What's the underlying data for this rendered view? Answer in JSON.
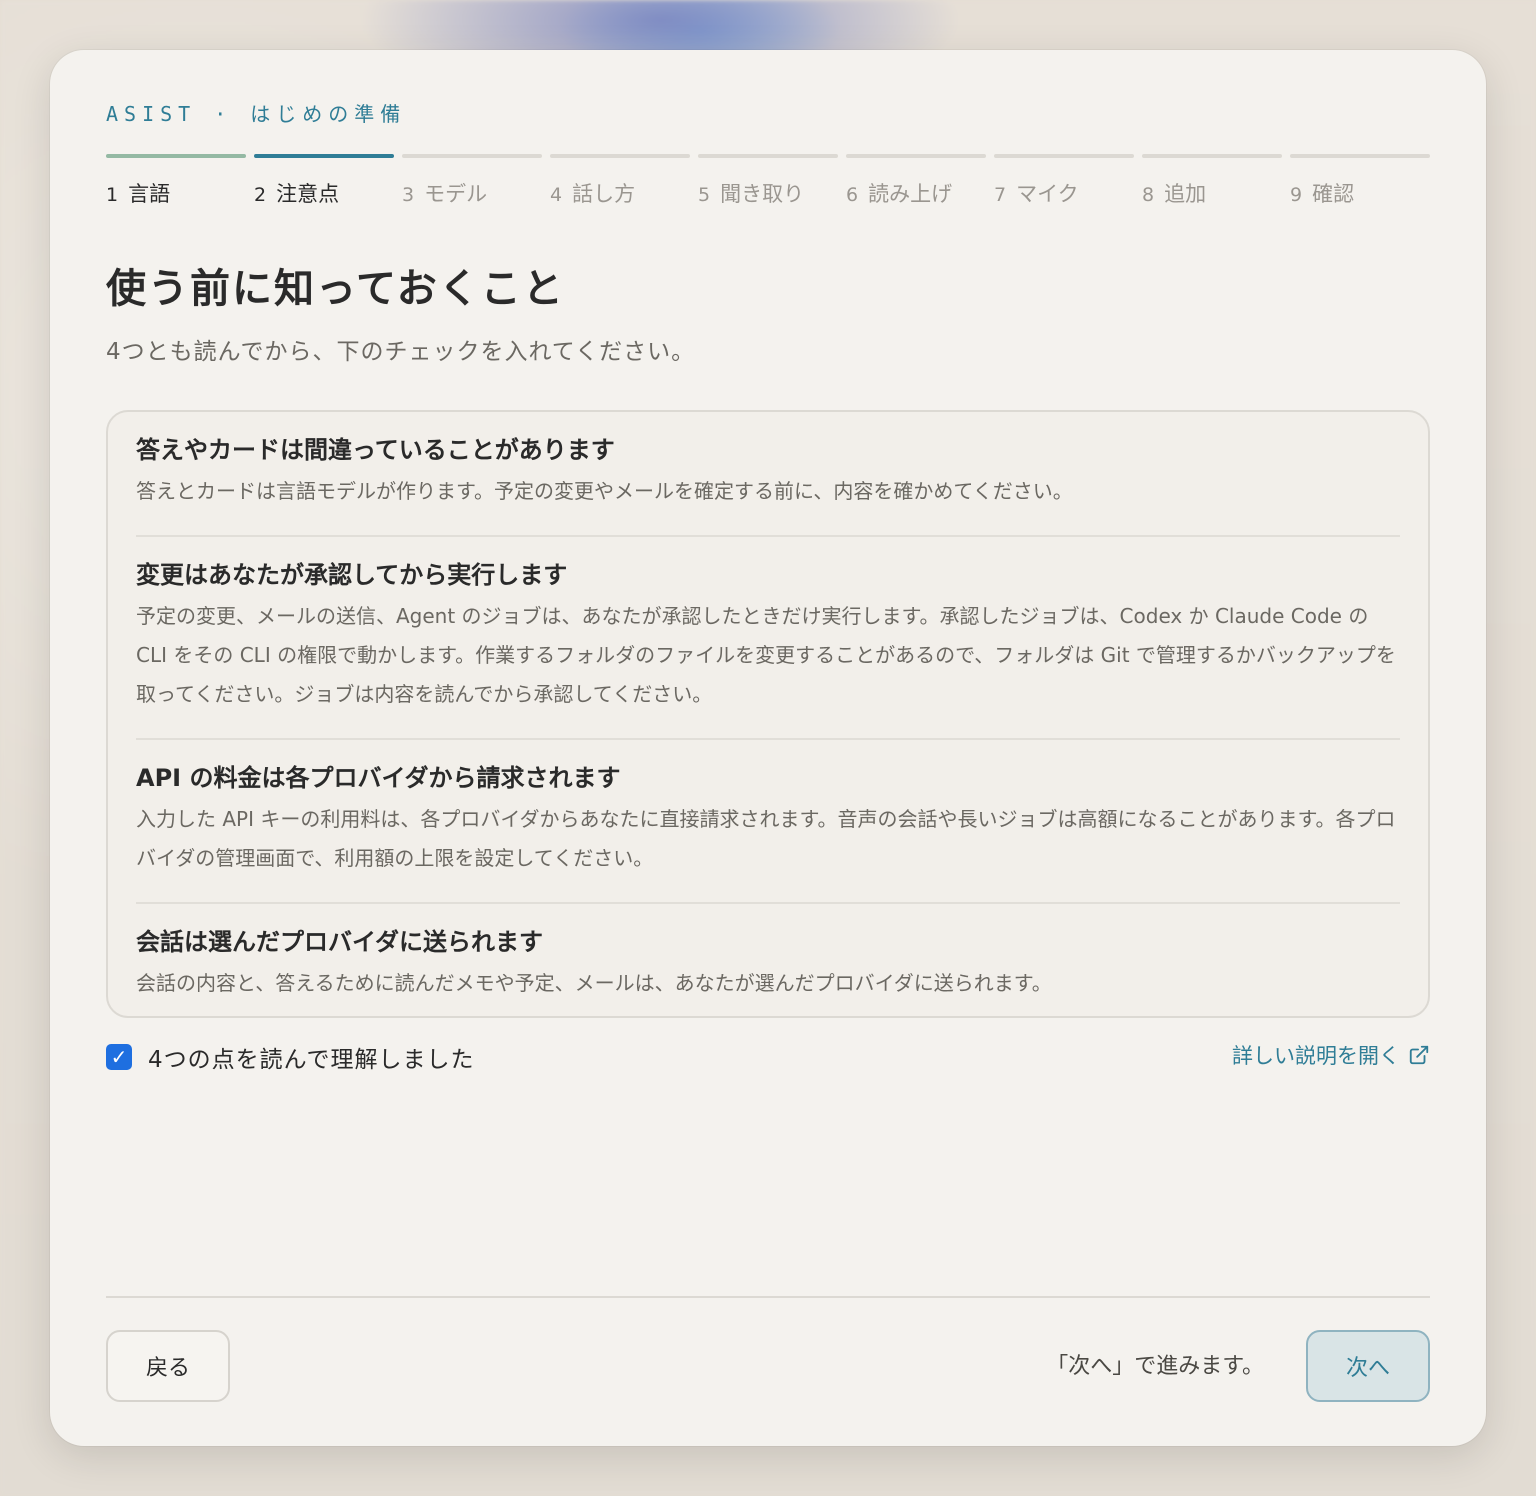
{
  "header": {
    "brand": "ASIST",
    "separator": "·",
    "section": "はじめの準備"
  },
  "steps": [
    {
      "num": "1",
      "label": "言語",
      "state": "done"
    },
    {
      "num": "2",
      "label": "注意点",
      "state": "active"
    },
    {
      "num": "3",
      "label": "モデル",
      "state": "pending"
    },
    {
      "num": "4",
      "label": "話し方",
      "state": "pending"
    },
    {
      "num": "5",
      "label": "聞き取り",
      "state": "pending"
    },
    {
      "num": "6",
      "label": "読み上げ",
      "state": "pending"
    },
    {
      "num": "7",
      "label": "マイク",
      "state": "pending"
    },
    {
      "num": "8",
      "label": "追加",
      "state": "pending"
    },
    {
      "num": "9",
      "label": "確認",
      "state": "pending"
    }
  ],
  "page": {
    "title": "使う前に知っておくこと",
    "subtitle": "4つとも読んでから、下のチェックを入れてください。"
  },
  "notices": [
    {
      "title": "答えやカードは間違っていることがあります",
      "body": "答えとカードは言語モデルが作ります。予定の変更やメールを確定する前に、内容を確かめてください。"
    },
    {
      "title": "変更はあなたが承認してから実行します",
      "body": "予定の変更、メールの送信、Agent のジョブは、あなたが承認したときだけ実行します。承認したジョブは、Codex か Claude Code の CLI をその CLI の権限で動かします。作業するフォルダのファイルを変更することがあるので、フォルダは Git で管理するかバックアップを取ってください。ジョブは内容を読んでから承認してください。"
    },
    {
      "title": "API の料金は各プロバイダから請求されます",
      "body": "入力した API キーの利用料は、各プロバイダからあなたに直接請求されます。音声の会話や長いジョブは高額になることがあります。各プロバイダの管理画面で、利用額の上限を設定してください。"
    },
    {
      "title": "会話は選んだプロバイダに送られます",
      "body": "会話の内容と、答えるために読んだメモや予定、メールは、あなたが選んだプロバイダに送られます。"
    }
  ],
  "agreement": {
    "label": "4つの点を読んで理解しました",
    "checked": true
  },
  "details_link": {
    "label": "詳しい説明を開く",
    "icon": "external-link-icon"
  },
  "footer": {
    "back_label": "戻る",
    "hint": "「次へ」で進みます。",
    "next_label": "次へ"
  },
  "colors": {
    "accent": "#2f7d96",
    "checkbox": "#1e6fe0",
    "step_done": "#94b9a3"
  }
}
